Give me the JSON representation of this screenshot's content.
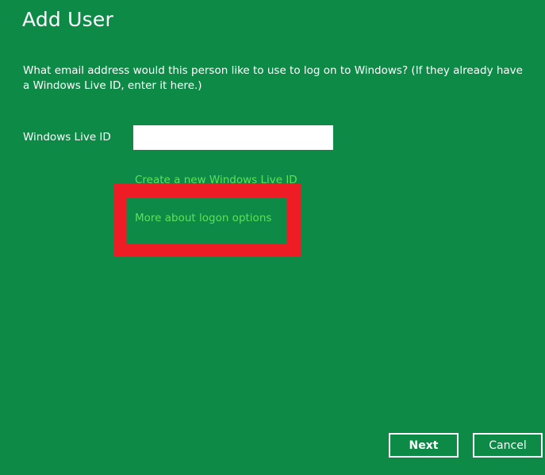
{
  "page": {
    "title": "Add User",
    "prompt": "What email address would this person like to use to log on to Windows? (If they already have a Windows Live ID, enter it here.)"
  },
  "form": {
    "label": "Windows Live ID",
    "value": ""
  },
  "links": {
    "create": "Create a new Windows Live ID",
    "more": "More about logon options"
  },
  "buttons": {
    "next": "Next",
    "cancel": "Cancel"
  },
  "colors": {
    "background": "#0e8a47",
    "link": "#5fe05a",
    "highlight": "#ee1c25"
  }
}
